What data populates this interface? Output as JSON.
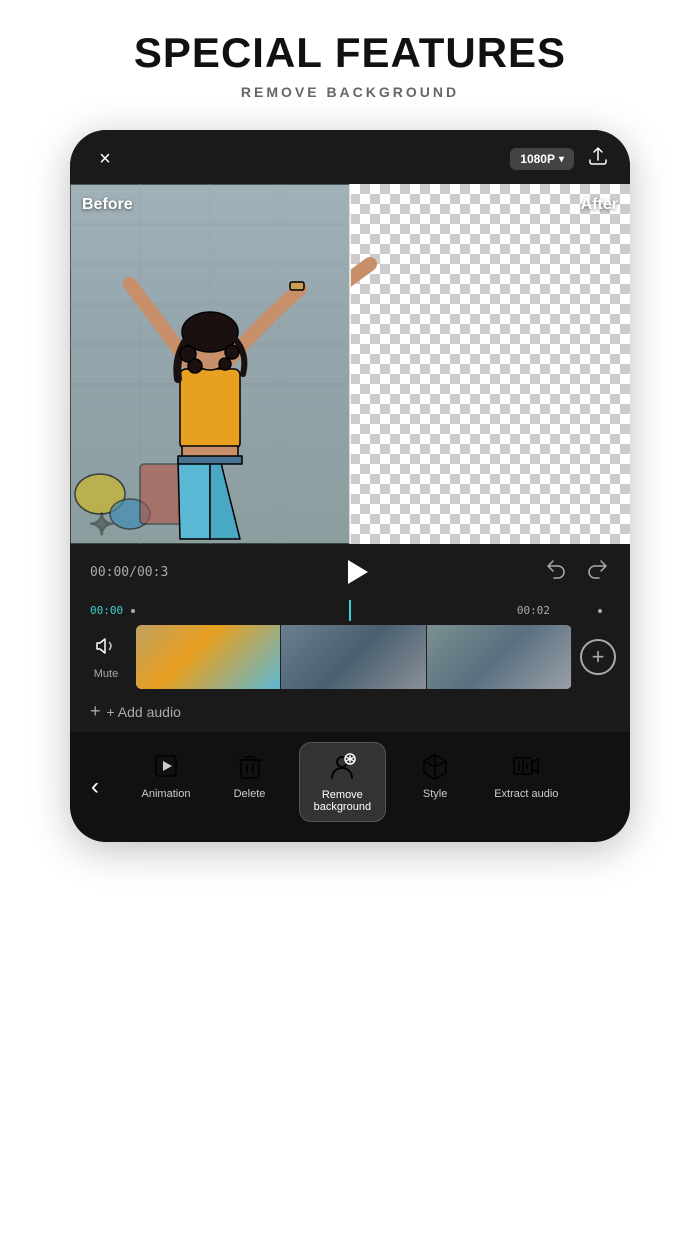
{
  "header": {
    "title": "SPECIAL FEATURES",
    "subtitle": "REMOVE BACKGROUND"
  },
  "phone": {
    "topbar": {
      "close_label": "×",
      "resolution": "1080P",
      "resolution_arrow": "▾"
    },
    "preview": {
      "before_label": "Before",
      "after_label": "After"
    },
    "playback": {
      "timecode": "00:00/00:3",
      "undo_icon": "undo-icon",
      "redo_icon": "redo-icon"
    },
    "timeline": {
      "mark_start": "00:00",
      "mark_mid": "00:02",
      "dot1": "•",
      "dot2": "•"
    },
    "mute": {
      "label": "Mute"
    },
    "add_audio": {
      "label": "+ Add audio"
    },
    "toolbar": {
      "back_icon": "chevron-left-icon",
      "items": [
        {
          "id": "animation",
          "label": "Animation",
          "icon": "animation-icon"
        },
        {
          "id": "delete",
          "label": "Delete",
          "icon": "delete-icon"
        },
        {
          "id": "remove-bg",
          "label": "Remove\nbackground",
          "icon": "remove-bg-icon",
          "active": true
        },
        {
          "id": "style",
          "label": "Style",
          "icon": "style-icon"
        },
        {
          "id": "extract-audio",
          "label": "Extract audio",
          "icon": "extract-audio-icon"
        }
      ]
    }
  }
}
